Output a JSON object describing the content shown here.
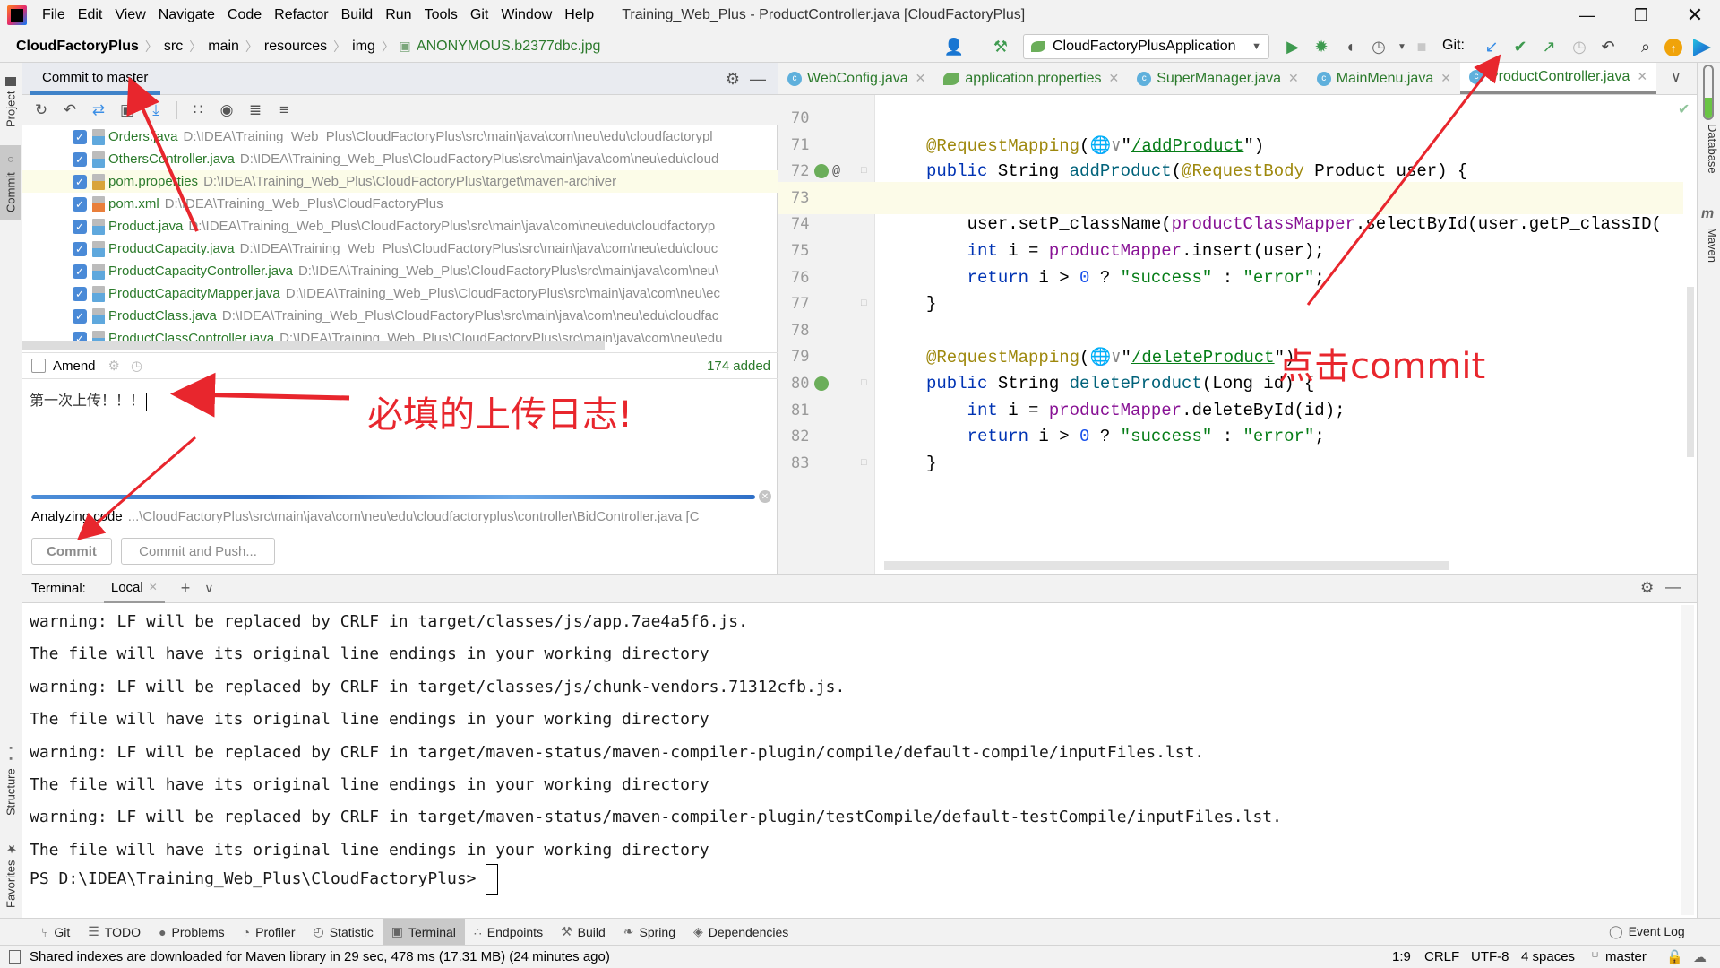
{
  "window": {
    "title": "Training_Web_Plus - ProductController.java [CloudFactoryPlus]",
    "menu": [
      "File",
      "Edit",
      "View",
      "Navigate",
      "Code",
      "Refactor",
      "Build",
      "Run",
      "Tools",
      "Git",
      "Window",
      "Help"
    ]
  },
  "breadcrumb": [
    "CloudFactoryPlus",
    "src",
    "main",
    "resources",
    "img",
    "ANONYMOUS.b2377dbc.jpg"
  ],
  "toolbar": {
    "run_config": "CloudFactoryPlusApplication",
    "git_label": "Git:"
  },
  "left_strip": {
    "project": "Project",
    "commit": "Commit",
    "structure": "Structure",
    "favorites": "Favorites"
  },
  "right_strip": {
    "database": "Database",
    "maven": "Maven"
  },
  "commit_panel": {
    "tab": "Commit to master",
    "files": [
      {
        "name": "Orders.java",
        "path": "D:\\IDEA\\Training_Web_Plus\\CloudFactoryPlus\\src\\main\\java\\com\\neu\\edu\\cloudfactorypl",
        "type": "java"
      },
      {
        "name": "OthersController.java",
        "path": "D:\\IDEA\\Training_Web_Plus\\CloudFactoryPlus\\src\\main\\java\\com\\neu\\edu\\cloud",
        "type": "java"
      },
      {
        "name": "pom.properties",
        "path": "D:\\IDEA\\Training_Web_Plus\\CloudFactoryPlus\\target\\maven-archiver",
        "type": "prop"
      },
      {
        "name": "pom.xml",
        "path": "D:\\IDEA\\Training_Web_Plus\\CloudFactoryPlus",
        "type": "xml"
      },
      {
        "name": "Product.java",
        "path": "D:\\IDEA\\Training_Web_Plus\\CloudFactoryPlus\\src\\main\\java\\com\\neu\\edu\\cloudfactoryp",
        "type": "java"
      },
      {
        "name": "ProductCapacity.java",
        "path": "D:\\IDEA\\Training_Web_Plus\\CloudFactoryPlus\\src\\main\\java\\com\\neu\\edu\\clouc",
        "type": "java"
      },
      {
        "name": "ProductCapacityController.java",
        "path": "D:\\IDEA\\Training_Web_Plus\\CloudFactoryPlus\\src\\main\\java\\com\\neu\\",
        "type": "java"
      },
      {
        "name": "ProductCapacityMapper.java",
        "path": "D:\\IDEA\\Training_Web_Plus\\CloudFactoryPlus\\src\\main\\java\\com\\neu\\ec",
        "type": "java"
      },
      {
        "name": "ProductClass.java",
        "path": "D:\\IDEA\\Training_Web_Plus\\CloudFactoryPlus\\src\\main\\java\\com\\neu\\edu\\cloudfac",
        "type": "java"
      },
      {
        "name": "ProductClassController.java",
        "path": "D:\\IDEA\\Training_Web_Plus\\CloudFactoryPlus\\src\\main\\java\\com\\neu\\edu",
        "type": "java"
      }
    ],
    "amend_label": "Amend",
    "added_count": "174 added",
    "message": "第一次上传！！！",
    "progress_percent": 100,
    "analyzing_label": "Analyzing code",
    "analyzing_path": "...\\CloudFactoryPlus\\src\\main\\java\\com\\neu\\edu\\cloudfactoryplus\\controller\\BidController.java [C",
    "commit_button": "Commit",
    "commit_push_button": "Commit and Push..."
  },
  "editor": {
    "tabs": [
      {
        "label": "WebConfig.java",
        "icon": "class"
      },
      {
        "label": "application.properties",
        "icon": "spring"
      },
      {
        "label": "SuperManager.java",
        "icon": "class"
      },
      {
        "label": "MainMenu.java",
        "icon": "class"
      },
      {
        "label": "ProductController.java",
        "icon": "class",
        "active": true
      }
    ],
    "lines": [
      {
        "n": "70",
        "html": ""
      },
      {
        "n": "71",
        "html": "<span class='ann'>@RequestMapping</span>(<span style='color:#888'>&#x1F310;&#x2228;</span>\"<span class='url'>/addProduct</span>\")"
      },
      {
        "n": "72",
        "html": "<span class='kw'>public</span> String <span class='fn'>addProduct</span>(<span class='ann'>@RequestBody</span> Product user) {"
      },
      {
        "n": "73",
        "html": ""
      },
      {
        "n": "74",
        "html": "    user.setP_className(<span class='fld'>productClassMapper</span>.selectById(user.getP_classID("
      },
      {
        "n": "75",
        "html": "    <span class='kw'>int</span> i = <span class='fld'>productMapper</span>.insert(user);"
      },
      {
        "n": "76",
        "html": "    <span class='kw'>return</span> i &gt; <span class='num'>0</span> ? <span class='str'>\"success\"</span> : <span class='str'>\"error\"</span>;"
      },
      {
        "n": "77",
        "html": "}"
      },
      {
        "n": "78",
        "html": ""
      },
      {
        "n": "79",
        "html": "<span class='ann'>@RequestMapping</span>(<span style='color:#888'>&#x1F310;&#x2228;</span>\"<span class='url'>/deleteProduct</span>\")"
      },
      {
        "n": "80",
        "html": "<span class='kw'>public</span> String <span class='fn'>deleteProduct</span>(Long id) {"
      },
      {
        "n": "81",
        "html": "    <span class='kw'>int</span> i = <span class='fld'>productMapper</span>.deleteById(id);"
      },
      {
        "n": "82",
        "html": "    <span class='kw'>return</span> i &gt; <span class='num'>0</span> ? <span class='str'>\"success\"</span> : <span class='str'>\"error\"</span>;"
      },
      {
        "n": "83",
        "html": "}"
      }
    ]
  },
  "terminal": {
    "label": "Terminal:",
    "tab": "Local",
    "lines": [
      "warning: LF will be replaced by CRLF in target/classes/js/app.7ae4a5f6.js.",
      "The file will have its original line endings in your working directory",
      "warning: LF will be replaced by CRLF in target/classes/js/chunk-vendors.71312cfb.js.",
      "The file will have its original line endings in your working directory",
      "warning: LF will be replaced by CRLF in target/maven-status/maven-compiler-plugin/compile/default-compile/inputFiles.lst.",
      "The file will have its original line endings in your working directory",
      "warning: LF will be replaced by CRLF in target/maven-status/maven-compiler-plugin/testCompile/default-testCompile/inputFiles.lst.",
      "The file will have its original line endings in your working directory"
    ],
    "prompt": "PS D:\\IDEA\\Training_Web_Plus\\CloudFactoryPlus>"
  },
  "tool_windows": [
    {
      "label": "Git",
      "icon": "branch-icon"
    },
    {
      "label": "TODO",
      "icon": "list-icon"
    },
    {
      "label": "Problems",
      "icon": "problems-icon"
    },
    {
      "label": "Profiler",
      "icon": "profiler-icon"
    },
    {
      "label": "Statistic",
      "icon": "statistic-icon"
    },
    {
      "label": "Terminal",
      "icon": "terminal-icon",
      "active": true
    },
    {
      "label": "Endpoints",
      "icon": "endpoints-icon"
    },
    {
      "label": "Build",
      "icon": "hammer-icon"
    },
    {
      "label": "Spring",
      "icon": "spring-icon"
    },
    {
      "label": "Dependencies",
      "icon": "dependencies-icon"
    }
  ],
  "event_log": "Event Log",
  "status": {
    "message": "Shared indexes are downloaded for Maven library in 29 sec, 478 ms (17.31 MB) (24 minutes ago)",
    "position": "1:9",
    "line_sep": "CRLF",
    "encoding": "UTF-8",
    "indent": "4 spaces",
    "branch": "master"
  },
  "annotations": {
    "message_hint": "必填的上传日志!",
    "click_hint": "点击commit"
  },
  "colors": {
    "accent": "#4083c9",
    "annotation": "#e8262d",
    "vcs_added": "#2b7a2b"
  }
}
